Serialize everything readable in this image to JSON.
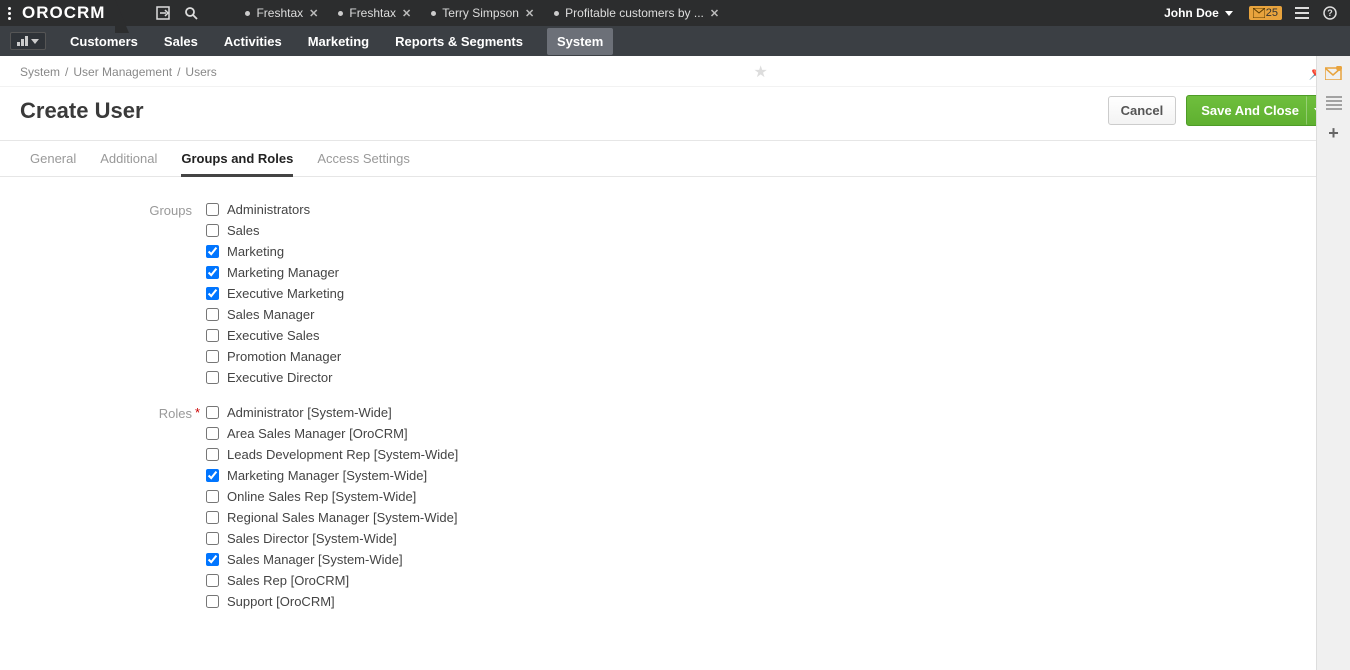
{
  "top": {
    "logo": "OROCRM",
    "tabs": [
      {
        "label": "Freshtax"
      },
      {
        "label": "Freshtax"
      },
      {
        "label": "Terry Simpson"
      },
      {
        "label": "Profitable customers by ..."
      }
    ],
    "user": "John Doe",
    "notif_count": "25"
  },
  "nav": {
    "items": [
      "Customers",
      "Sales",
      "Activities",
      "Marketing",
      "Reports & Segments",
      "System"
    ],
    "active_index": 5
  },
  "breadcrumb": [
    "System",
    "User Management",
    "Users"
  ],
  "page": {
    "title": "Create User",
    "cancel": "Cancel",
    "save": "Save And Close"
  },
  "form_tabs": [
    "General",
    "Additional",
    "Groups and Roles",
    "Access Settings"
  ],
  "form_tab_active": 2,
  "labels": {
    "groups": "Groups",
    "roles": "Roles"
  },
  "groups": [
    {
      "label": "Administrators",
      "checked": false
    },
    {
      "label": "Sales",
      "checked": false
    },
    {
      "label": "Marketing",
      "checked": true
    },
    {
      "label": "Marketing Manager",
      "checked": true
    },
    {
      "label": "Executive Marketing",
      "checked": true
    },
    {
      "label": "Sales Manager",
      "checked": false
    },
    {
      "label": "Executive Sales",
      "checked": false
    },
    {
      "label": "Promotion Manager",
      "checked": false
    },
    {
      "label": "Executive Director",
      "checked": false
    }
  ],
  "roles": [
    {
      "label": "Administrator [System-Wide]",
      "checked": false
    },
    {
      "label": "Area Sales Manager [OroCRM]",
      "checked": false
    },
    {
      "label": "Leads Development Rep [System-Wide]",
      "checked": false
    },
    {
      "label": "Marketing Manager [System-Wide]",
      "checked": true
    },
    {
      "label": "Online Sales Rep [System-Wide]",
      "checked": false
    },
    {
      "label": "Regional Sales Manager [System-Wide]",
      "checked": false
    },
    {
      "label": "Sales Director [System-Wide]",
      "checked": false
    },
    {
      "label": "Sales Manager [System-Wide]",
      "checked": true
    },
    {
      "label": "Sales Rep [OroCRM]",
      "checked": false
    },
    {
      "label": "Support [OroCRM]",
      "checked": false
    }
  ]
}
